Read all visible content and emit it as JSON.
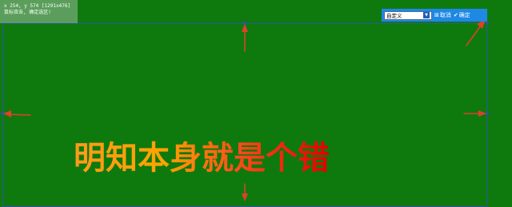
{
  "info_panel": {
    "line1": "x 254, y 574 [1291x476]",
    "line2": "鼠标双击, 确定选区!"
  },
  "toolbar": {
    "mode_value": "自定义",
    "cancel_label": "取消",
    "confirm_label": "确定",
    "cancel_icon": "close-icon",
    "confirm_icon": "check-icon"
  },
  "caption": {
    "text": "明知本身就是个错"
  },
  "colors": {
    "background": "#0e7a0e",
    "selection_border": "#2f55a8",
    "toolbar_bg": "#1e88e5",
    "arrow": "#e0402a"
  }
}
